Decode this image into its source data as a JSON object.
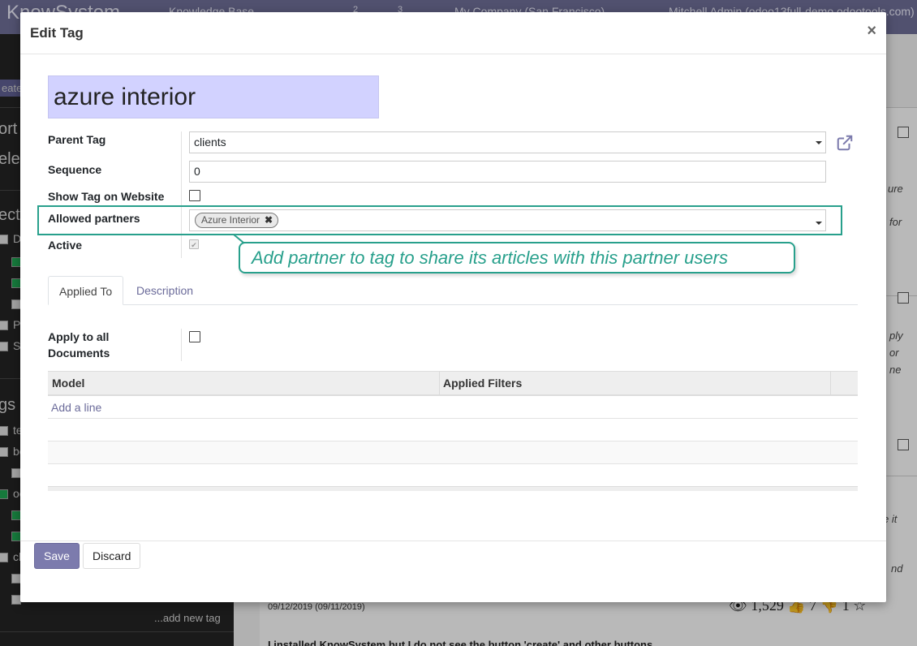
{
  "background": {
    "brand": "KnowSystem",
    "topbar_items": [
      "Knowledge Base",
      "2",
      "3",
      "My Company (San Francisco)",
      "Mitchell Admin (odoo13full-demo.odootools.com)"
    ],
    "sidebar": {
      "frag_create": "eate",
      "frag_sort": "ort b",
      "frag_select": "elec",
      "frag_sections": "ectio",
      "frag_do": "Do",
      "frag_po": "Po",
      "frag_sp": "Sp",
      "frag_tags": "gs",
      "frag_te": "te",
      "frag_be": "be",
      "frag_oo": "oo",
      "frag_cli": "cli",
      "add_tag": "...add new tag"
    },
    "main": {
      "article_date": "09/12/2019 (09/11/2019)",
      "article_views": "1,529",
      "article_likes": "7",
      "article_dislikes": "1",
      "next_article_title": "I installed KnowSystem but I do not see the button 'create' and other buttons",
      "frag_ure": "ure",
      "frag_for": "for",
      "frag_ply": "ply",
      "frag_or": "or",
      "frag_ne": "ne",
      "frag_eit": "e it",
      "frag_nd": "nd"
    }
  },
  "modal": {
    "title": "Edit Tag",
    "close_label": "×",
    "name_value": "azure interior",
    "fields": {
      "parent_tag_label": "Parent Tag",
      "parent_tag_value": "clients",
      "sequence_label": "Sequence",
      "sequence_value": "0",
      "show_on_website_label": "Show Tag on Website",
      "show_on_website_checked": false,
      "allowed_partners_label": "Allowed partners",
      "allowed_partners_tags": [
        "Azure Interior"
      ],
      "active_label": "Active",
      "active_checked": true
    },
    "tooltip": "Add partner to tag to share its articles with this partner users",
    "tabs": [
      {
        "label": "Applied To",
        "active": true
      },
      {
        "label": "Description",
        "active": false
      }
    ],
    "applied_to": {
      "apply_all_label_1": "Apply to all",
      "apply_all_label_2": "Documents",
      "apply_all_checked": false,
      "columns": [
        "Model",
        "Applied Filters"
      ],
      "add_line_label": "Add a line"
    },
    "footer": {
      "save_label": "Save",
      "discard_label": "Discard"
    }
  },
  "colors": {
    "accent": "#7c7bad",
    "highlight": "#28a08c",
    "name_bg": "#d2d2ff"
  }
}
